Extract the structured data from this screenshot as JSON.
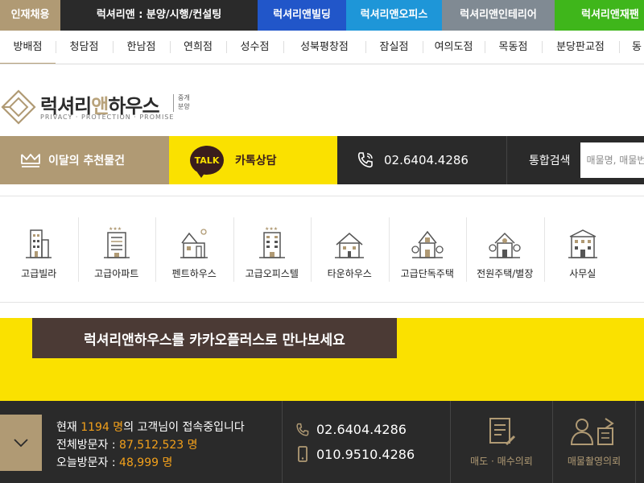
{
  "top_tabs": [
    {
      "label": "인재채용",
      "color": "#b09a74"
    },
    {
      "label": "럭셔리앤 : 분양/시행/컨설팅",
      "color": "#2a2a2a"
    },
    {
      "label": "럭셔리앤빌딩",
      "color": "#2156c9"
    },
    {
      "label": "럭셔리앤오피스",
      "color": "#1e96d8"
    },
    {
      "label": "럭셔리앤인테리어",
      "color": "#808a93"
    },
    {
      "label": "럭셔리앤재팬",
      "color": "#3fb61b"
    }
  ],
  "branches": [
    "방배점",
    "청담점",
    "한남점",
    "연희점",
    "성수점",
    "성북평창점",
    "잠실점",
    "여의도점",
    "목동점",
    "분당판교점",
    "동"
  ],
  "logo": {
    "name_left": "럭셔리",
    "name_accent": "앤",
    "name_right": "하우스",
    "tagline": "PRIVACY · PROTECTION · PROMISE",
    "sub_line1": "중개",
    "sub_line2": "분양"
  },
  "actions": {
    "recommend": "이달의 추천물건",
    "talk_badge": "TALK",
    "kakao": "카톡상담",
    "phone": "02.6404.4286",
    "search_label": "통합검색",
    "search_placeholder": "매물명, 매물번호"
  },
  "categories": [
    {
      "label": "고급빌라",
      "icon": "villa-icon"
    },
    {
      "label": "고급아파트",
      "icon": "apartment-icon"
    },
    {
      "label": "펜트하우스",
      "icon": "penthouse-icon"
    },
    {
      "label": "고급오피스텔",
      "icon": "officetel-icon"
    },
    {
      "label": "타운하우스",
      "icon": "townhouse-icon"
    },
    {
      "label": "고급단독주택",
      "icon": "detached-house-icon"
    },
    {
      "label": "전원주택/별장",
      "icon": "country-house-icon"
    },
    {
      "label": "사무실",
      "icon": "office-icon"
    }
  ],
  "banner": {
    "text": "럭셔리앤하우스를 카카오플러스로 만나보세요"
  },
  "footer": {
    "current_prefix": "현재 ",
    "current_count": "1194 명",
    "current_suffix": "의 고객님이 접속중입니다",
    "total_label": "전체방문자 : ",
    "total_value": "87,512,523 명",
    "today_label": "오늘방문자 : ",
    "today_value": "48,999 명",
    "phone": "02.6404.4286",
    "mobile": "010.9510.4286",
    "btn_sell": "매도 · 매수의뢰",
    "btn_photo": "매물촬영의뢰"
  },
  "colors": {
    "gold": "#b09a74",
    "kakao_yellow": "#fae100",
    "dark": "#2a2a2a",
    "highlight": "#f2a01b"
  }
}
